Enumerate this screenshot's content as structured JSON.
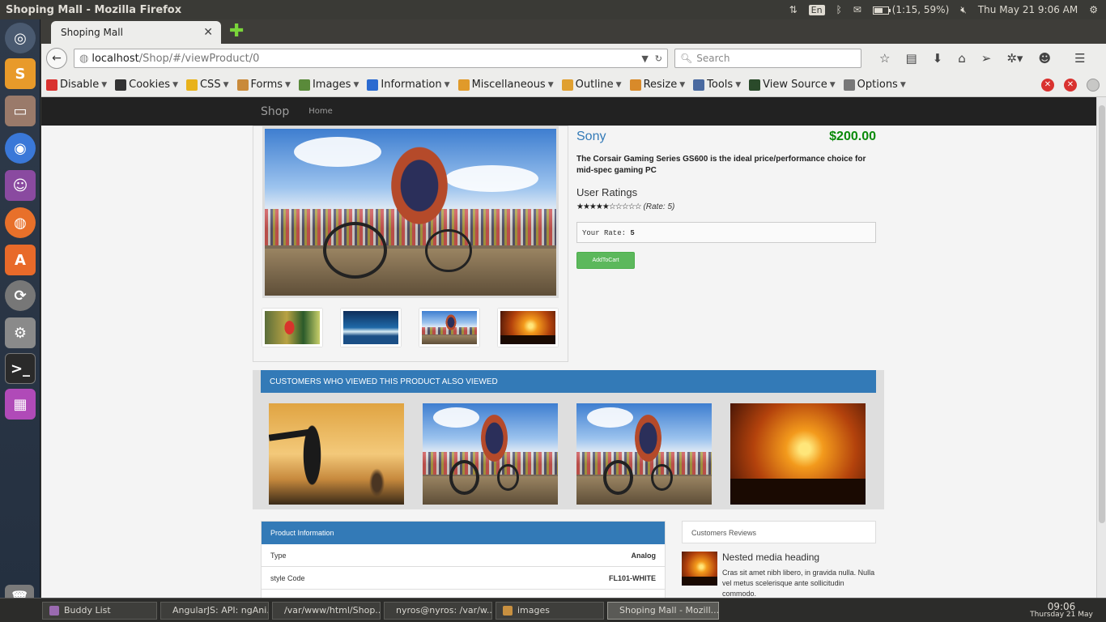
{
  "top_panel": {
    "window_title": "Shoping Mall - Mozilla Firefox",
    "keyboard_lang": "En",
    "battery_text": "(1:15, 59%)",
    "battery_level": 0.59,
    "datetime": "Thu May 21  9:06 AM"
  },
  "firefox": {
    "tab_title": "Shoping Mall",
    "url_host": "localhost",
    "url_path": "/Shop/#/viewProduct/0",
    "search_placeholder": "Search",
    "devbar": [
      {
        "label": "Disable",
        "icon": "disable-icon",
        "color": "#d9322f"
      },
      {
        "label": "Cookies",
        "icon": "cookies-icon",
        "color": "#333333"
      },
      {
        "label": "CSS",
        "icon": "css-icon",
        "color": "#e8b21a"
      },
      {
        "label": "Forms",
        "icon": "forms-icon",
        "color": "#c98a3a"
      },
      {
        "label": "Images",
        "icon": "images-icon",
        "color": "#5a8a3a"
      },
      {
        "label": "Information",
        "icon": "information-icon",
        "color": "#2a6ad0"
      },
      {
        "label": "Miscellaneous",
        "icon": "miscellaneous-icon",
        "color": "#e09a2a"
      },
      {
        "label": "Outline",
        "icon": "outline-icon",
        "color": "#e0a030"
      },
      {
        "label": "Resize",
        "icon": "resize-icon",
        "color": "#d88a2a"
      },
      {
        "label": "Tools",
        "icon": "tools-icon",
        "color": "#4a6aa0"
      },
      {
        "label": "View Source",
        "icon": "view-source-icon",
        "color": "#2a4a2a"
      },
      {
        "label": "Options",
        "icon": "options-icon",
        "color": "#777777"
      }
    ]
  },
  "site": {
    "brand": "Shop",
    "nav_home": "Home",
    "product": {
      "name": "Sony",
      "price": "$200.00",
      "description": "The Corsair Gaming Series GS600 is the ideal price/performance choice for mid-spec gaming PC",
      "ratings_heading": "User Ratings",
      "stars": "★★★★★☆☆☆☆☆",
      "rating_label": "(Rate: 5)",
      "rating_value": 5,
      "rating_max": 10,
      "your_rate_label": "Your Rate:",
      "your_rate_value": "5",
      "add_to_cart": "AddToCart"
    },
    "also_viewed_title": "CUSTOMERS WHO VIEWED THIS PRODUCT ALSO VIEWED",
    "product_info": {
      "title": "Product Information",
      "rows": [
        {
          "label": "Type",
          "value": "Analog"
        },
        {
          "label": "style Code",
          "value": "FL101-WHITE"
        }
      ]
    },
    "reviews": {
      "title": "Customers Reviews",
      "media_heading": "Nested media heading",
      "media_text": "Cras sit amet nibh libero, in gravida nulla. Nulla vel metus scelerisque ante sollicitudin commodo."
    }
  },
  "taskbar": {
    "items": [
      {
        "label": "Buddy List",
        "icon": "pidgin-icon",
        "color": "#9a6ab0"
      },
      {
        "label": "AngularJS: API: ngAni...",
        "icon": "chromium-icon",
        "color": "#4a8ad8"
      },
      {
        "label": "/var/www/html/Shop...",
        "icon": "text-editor-icon",
        "color": "#d8d6d0"
      },
      {
        "label": "nyros@nyros: /var/w...",
        "icon": "terminal-icon",
        "color": "#2a2a2a"
      },
      {
        "label": "images",
        "icon": "folder-icon",
        "color": "#c89040"
      },
      {
        "label": "Shoping Mall - Mozill...",
        "icon": "firefox-icon",
        "color": "#e8702a"
      }
    ],
    "clock_time": "09:06",
    "clock_date": "Thursday 21 May"
  }
}
